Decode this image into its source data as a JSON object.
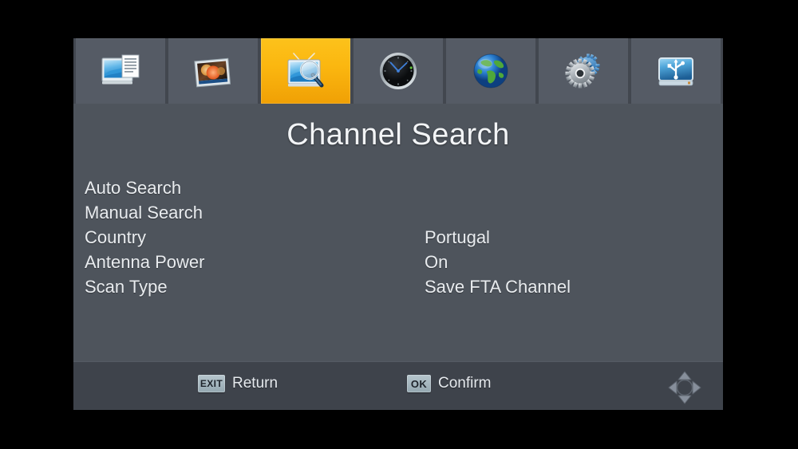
{
  "toolbar": {
    "items": [
      {
        "name": "tv-document-icon",
        "label": "Program",
        "selected": false
      },
      {
        "name": "picture-icon",
        "label": "Picture",
        "selected": false
      },
      {
        "name": "tv-search-icon",
        "label": "Channel Search",
        "selected": true
      },
      {
        "name": "clock-icon",
        "label": "Time",
        "selected": false
      },
      {
        "name": "globe-icon",
        "label": "Option",
        "selected": false
      },
      {
        "name": "gears-icon",
        "label": "System",
        "selected": false
      },
      {
        "name": "usb-drive-icon",
        "label": "USB",
        "selected": false
      }
    ]
  },
  "page": {
    "title": "Channel Search"
  },
  "menu": {
    "rows": [
      {
        "label": "Auto Search",
        "value": ""
      },
      {
        "label": "Manual Search",
        "value": ""
      },
      {
        "label": "Country",
        "value": "Portugal"
      },
      {
        "label": "Antenna Power",
        "value": "On"
      },
      {
        "label": "Scan Type",
        "value": "Save FTA Channel"
      }
    ]
  },
  "statusbar": {
    "exit_key": "EXIT",
    "exit_action": "Return",
    "ok_key": "OK",
    "ok_action": "Confirm",
    "navigation_icon": "dpad-icon"
  },
  "colors": {
    "panel_background": "#4e545c",
    "toolbar_background": "#42474f",
    "tile_background": "#555b65",
    "tile_selected": "#fbb710",
    "statusbar_background": "#3e434b",
    "text": "#e9ecef",
    "keycap": "#a8bcc4",
    "screen_border": "#000000"
  }
}
